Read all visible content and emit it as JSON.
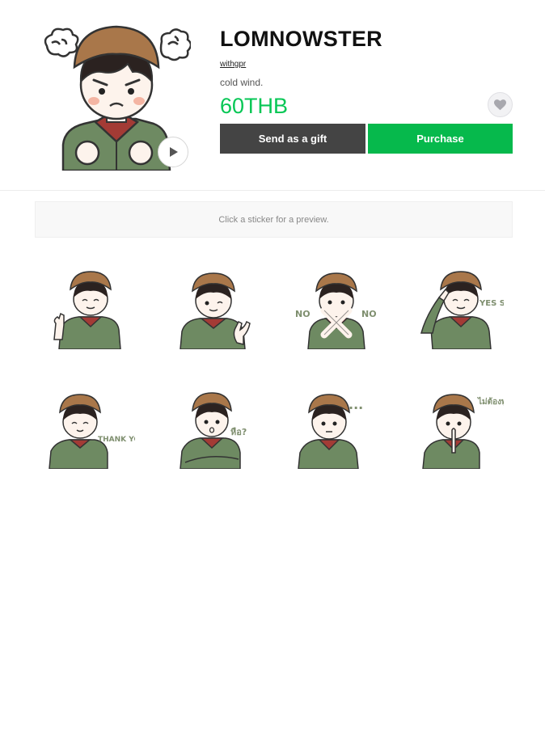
{
  "product": {
    "title": "LOMNOWSTER",
    "author": "withgpr",
    "description": "cold wind.",
    "price": "60THB"
  },
  "actions": {
    "gift_label": "Send as a gift",
    "purchase_label": "Purchase"
  },
  "preview": {
    "hint": "Click a sticker for a preview."
  },
  "colors": {
    "accent_green": "#06c755",
    "dark_button": "#444444",
    "jacket_green": "#6e8a62",
    "collar_red": "#a33b35",
    "hat_brown": "#a9774a"
  },
  "icons": [
    "play-icon",
    "heart-icon"
  ],
  "stickers": [
    {
      "id": 1,
      "text": ""
    },
    {
      "id": 2,
      "text": ""
    },
    {
      "id": 3,
      "text": "NO"
    },
    {
      "id": 4,
      "text": "YES SIR!"
    },
    {
      "id": 5,
      "text": "THANK YOU!"
    },
    {
      "id": 6,
      "text": "หือ?"
    },
    {
      "id": 7,
      "text": "..."
    },
    {
      "id": 8,
      "text": "ไม่ต้องพูด"
    }
  ]
}
